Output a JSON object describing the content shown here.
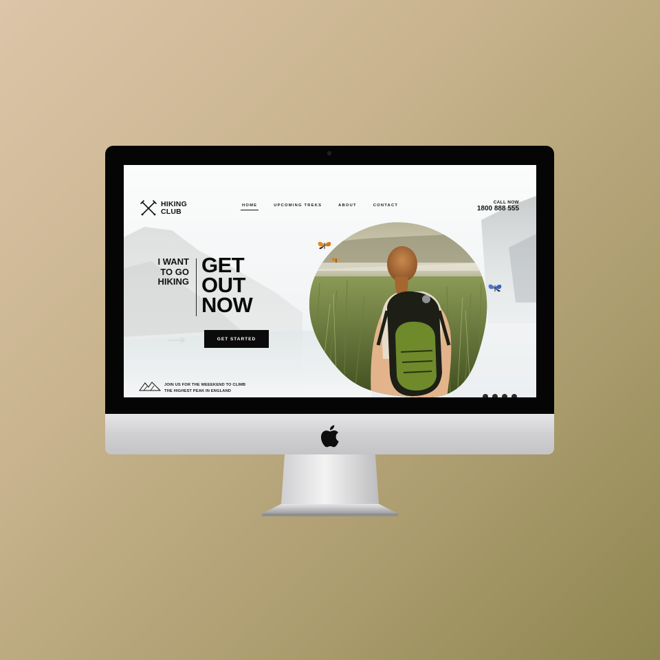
{
  "brand": {
    "line1": "HIKING",
    "line2": "CLUB",
    "icon": "crossed-trekking-poles-icon"
  },
  "nav": {
    "items": [
      {
        "label": "HOME",
        "active": true
      },
      {
        "label": "UPCOMING TREKS",
        "active": false
      },
      {
        "label": "ABOUT",
        "active": false
      },
      {
        "label": "CONTACT",
        "active": false
      }
    ]
  },
  "call": {
    "label": "CALL NOW",
    "number": "1800 888 555"
  },
  "hero": {
    "tagline": [
      "I WANT",
      "TO GO",
      "HIKING"
    ],
    "headline": [
      "GET",
      "OUT",
      "NOW"
    ],
    "cta_label": "GET STARTED"
  },
  "footer": {
    "join_lines": [
      "JOIN US FOR THE WEEEKEND TO CLIMB",
      "THE HIGHEST PEAK IN ENGLAND"
    ],
    "icon": "mountains-icon",
    "slider_dots": 4
  },
  "colors": {
    "text": "#111111",
    "cta_bg": "#0b0b0b",
    "cta_text": "#ffffff",
    "monitor_bezel": "#050505",
    "background": "#c9b48f"
  }
}
